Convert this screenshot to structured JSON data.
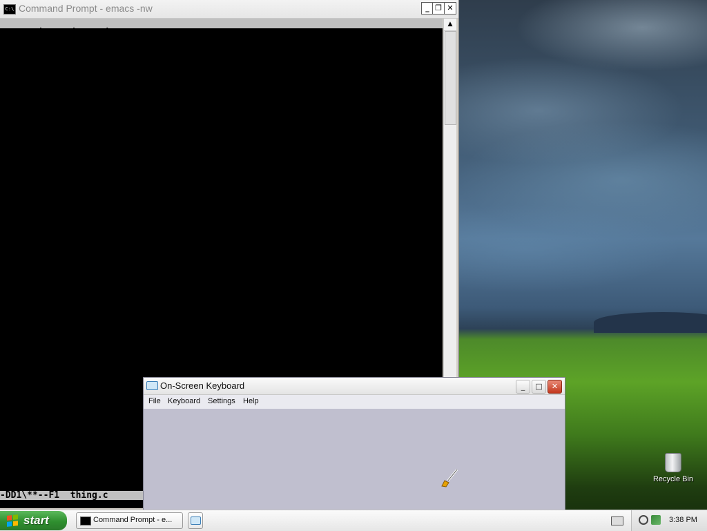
{
  "desktop": {
    "icons": [
      {
        "label": "Recycle Bin",
        "icon": "recycle-bin-icon"
      }
    ]
  },
  "cmd_window": {
    "title": "Command Prompt - emacs -nw",
    "icon_text": "C:\\",
    "buttons": {
      "minimize": "_",
      "restore": "❐",
      "close": "✕"
    },
    "emacs_menu": [
      "File",
      "Edit",
      "Options",
      "Buffers",
      "Tools",
      "C",
      "Help"
    ],
    "modeline": "-DD1\\**--F1  thing.c",
    "scroll_up": "▲"
  },
  "osk_window": {
    "title": "On-Screen Keyboard",
    "buttons": {
      "minimize": "_",
      "maximize": "□",
      "close": "✕"
    },
    "menu": [
      "File",
      "Keyboard",
      "Settings",
      "Help"
    ]
  },
  "taskbar": {
    "start_label": "start",
    "tasks": [
      {
        "label": "Command Prompt - e...",
        "icon": "cmd-icon"
      },
      {
        "label": "",
        "icon": "keyboard-icon"
      }
    ],
    "clock": "3:38 PM"
  }
}
